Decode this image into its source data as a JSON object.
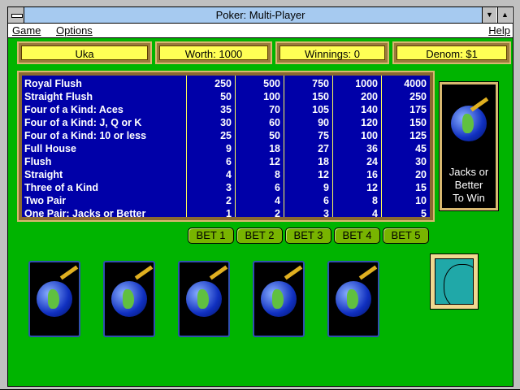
{
  "window": {
    "title": "Poker: Multi-Player"
  },
  "menu": {
    "game": "Game",
    "options": "Options",
    "help": "Help"
  },
  "info": {
    "player": "Uka",
    "worth": "Worth: 1000",
    "winnings": "Winnings: 0",
    "denom": "Denom: $1"
  },
  "paytable": [
    {
      "hand": "Royal Flush",
      "v": [
        "250",
        "500",
        "750",
        "1000",
        "4000"
      ]
    },
    {
      "hand": "Straight Flush",
      "v": [
        "50",
        "100",
        "150",
        "200",
        "250"
      ]
    },
    {
      "hand": "Four of a Kind: Aces",
      "v": [
        "35",
        "70",
        "105",
        "140",
        "175"
      ]
    },
    {
      "hand": "Four of a Kind: J, Q or K",
      "v": [
        "30",
        "60",
        "90",
        "120",
        "150"
      ]
    },
    {
      "hand": "Four of a Kind: 10 or less",
      "v": [
        "25",
        "50",
        "75",
        "100",
        "125"
      ]
    },
    {
      "hand": "Full House",
      "v": [
        "9",
        "18",
        "27",
        "36",
        "45"
      ]
    },
    {
      "hand": "Flush",
      "v": [
        "6",
        "12",
        "18",
        "24",
        "30"
      ]
    },
    {
      "hand": "Straight",
      "v": [
        "4",
        "8",
        "12",
        "16",
        "20"
      ]
    },
    {
      "hand": "Three of a Kind",
      "v": [
        "3",
        "6",
        "9",
        "12",
        "15"
      ]
    },
    {
      "hand": "Two Pair",
      "v": [
        "2",
        "4",
        "6",
        "8",
        "10"
      ]
    },
    {
      "hand": "One Pair: Jacks or Better",
      "v": [
        "1",
        "2",
        "3",
        "4",
        "5"
      ]
    }
  ],
  "bets": [
    "BET 1",
    "BET 2",
    "BET 3",
    "BET 4",
    "BET 5"
  ],
  "side": {
    "line1": "Jacks or",
    "line2": "Better",
    "line3": "To Win"
  },
  "colors": {
    "felt": "#00b400",
    "table": "#0000a8",
    "infobox": "#ffff55",
    "titlebar": "#a6caf0"
  }
}
